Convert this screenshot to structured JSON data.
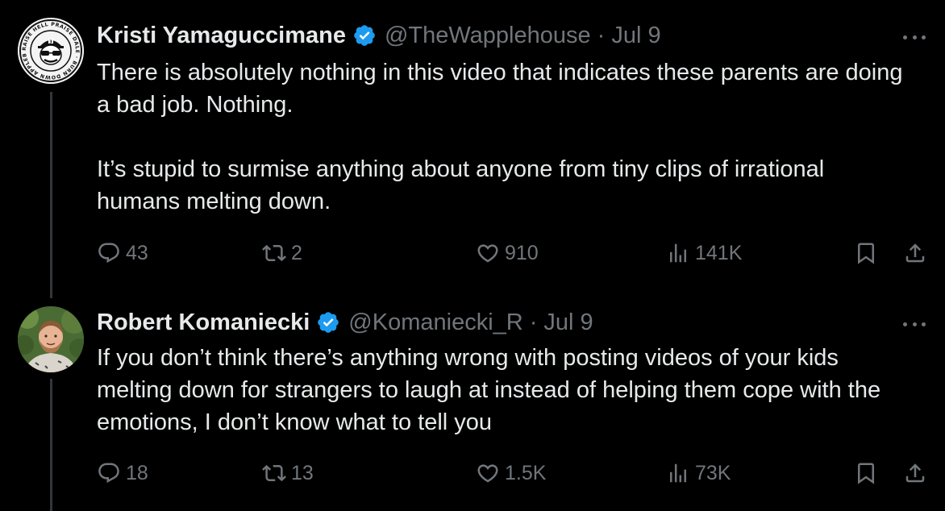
{
  "colors": {
    "background": "#000000",
    "text_primary": "#e7e9ea",
    "text_secondary": "#71767b",
    "verified_badge": "#1d9bf0",
    "thread_line": "#333639"
  },
  "tweets": [
    {
      "author_name": "Kristi Yamaguccimane",
      "verified": true,
      "handle": "@TheWapplehouse",
      "separator": "·",
      "date": "Jul 9",
      "paragraphs": [
        "There is absolutely nothing in this video that indicates these parents are doing a bad job. Nothing.",
        "It’s stupid to surmise anything about anyone from tiny clips of irrational humans melting down."
      ],
      "replies": "43",
      "reposts": "2",
      "likes": "910",
      "views": "141K",
      "avatar_icon": "badge-logo-avatar",
      "avatar_text": "RAISE HELL PRAISE DALE · BURN DOWN APPLEBEE'S"
    },
    {
      "author_name": "Robert Komaniecki",
      "verified": true,
      "handle": "@Komaniecki_R",
      "separator": "·",
      "date": "Jul 9",
      "paragraphs": [
        "If you don’t think there’s anything wrong with posting videos of your kids melting down for strangers to laugh at instead of helping them cope with the emotions, I don’t know what to tell you"
      ],
      "replies": "18",
      "reposts": "13",
      "likes": "1.5K",
      "views": "73K",
      "avatar_icon": "person-photo-avatar"
    }
  ],
  "icons": {
    "reply": "reply-icon",
    "repost": "repost-icon",
    "like": "heart-icon",
    "views": "views-chart-icon",
    "bookmark": "bookmark-icon",
    "share": "share-icon",
    "more": "more-dots-icon",
    "verified": "verified-badge-icon"
  }
}
